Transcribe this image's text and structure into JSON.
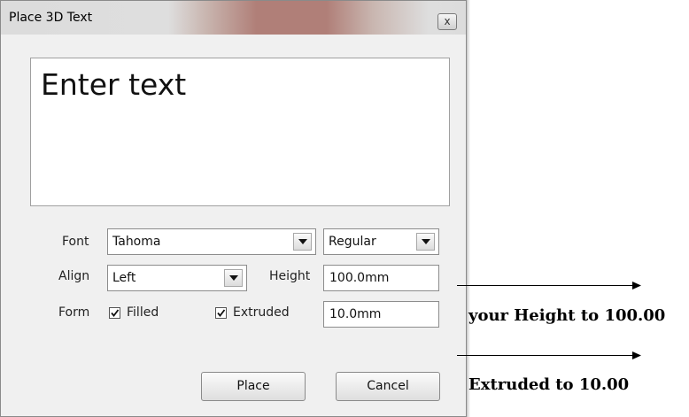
{
  "dialog": {
    "title": "Place 3D Text",
    "close_label": "x",
    "text_content": "Enter text"
  },
  "font": {
    "label": "Font",
    "family_value": "Tahoma",
    "style_value": "Regular"
  },
  "align": {
    "label": "Align",
    "value": "Left"
  },
  "height": {
    "label": "Height",
    "value": "100.0mm"
  },
  "form": {
    "label": "Form",
    "filled_label": "Filled",
    "filled_checked": true,
    "extruded_label": "Extruded",
    "extruded_checked": true,
    "extruded_value": "10.0mm"
  },
  "buttons": {
    "place_label": "Place",
    "cancel_label": "Cancel"
  },
  "annotations": {
    "height_note": "your Height to 100.00",
    "extruded_note": "Extruded to 10.00"
  }
}
